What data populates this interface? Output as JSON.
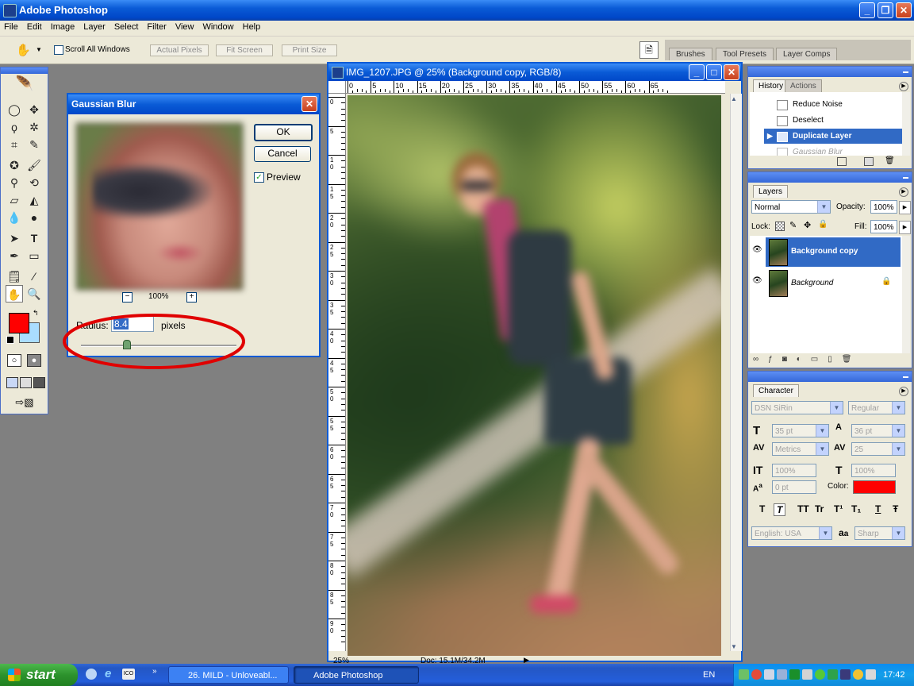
{
  "app": {
    "title": "Adobe Photoshop"
  },
  "menu": [
    "File",
    "Edit",
    "Image",
    "Layer",
    "Select",
    "Filter",
    "View",
    "Window",
    "Help"
  ],
  "options": {
    "scroll_all_windows": "Scroll All Windows",
    "actual_pixels": "Actual Pixels",
    "fit_screen": "Fit Screen",
    "print_size": "Print Size",
    "well_tabs": [
      "Brushes",
      "Tool Presets",
      "Layer Comps"
    ]
  },
  "colors": {
    "foreground": "#ff0000",
    "background": "#aaddff",
    "accent": "#0a5bd6",
    "annotation": "#e00000"
  },
  "gaussian_blur": {
    "title": "Gaussian Blur",
    "ok": "OK",
    "cancel": "Cancel",
    "preview_label": "Preview",
    "preview_checked": true,
    "zoom": "100%",
    "zoom_out": "−",
    "zoom_in": "+",
    "radius_label": "Radius:",
    "radius_value": "8.4",
    "unit": "pixels",
    "slider_fraction": 0.29
  },
  "document": {
    "title": "IMG_1207.JPG @ 25% (Background copy, RGB/8)",
    "ruler_top": [
      "0",
      "5",
      "10",
      "15",
      "20",
      "25",
      "30",
      "35",
      "40",
      "45",
      "50",
      "55",
      "60",
      "65"
    ],
    "ruler_left": [
      "0",
      "5",
      "1\n0",
      "1\n5",
      "2\n0",
      "2\n5",
      "3\n0",
      "3\n5",
      "4\n0",
      "4\n5",
      "5\n0",
      "5\n5",
      "6\n0",
      "6\n5",
      "7\n0",
      "7\n5",
      "8\n0",
      "8\n5",
      "9\n0"
    ],
    "status_zoom": "25%",
    "status_doc": "Doc: 15.1M/34.2M"
  },
  "history": {
    "tabs": [
      "History",
      "Actions"
    ],
    "items": [
      {
        "label": "Reduce Noise",
        "state": "normal"
      },
      {
        "label": "Deselect",
        "state": "normal"
      },
      {
        "label": "Duplicate Layer",
        "state": "selected"
      },
      {
        "label": "Gaussian Blur",
        "state": "undone"
      }
    ]
  },
  "layers": {
    "tab": "Layers",
    "blend_mode": "Normal",
    "opacity_label": "Opacity:",
    "opacity": "100%",
    "lock_label": "Lock:",
    "fill_label": "Fill:",
    "fill": "100%",
    "items": [
      {
        "name": "Background copy",
        "selected": true,
        "locked": false
      },
      {
        "name": "Background",
        "selected": false,
        "locked": true
      }
    ]
  },
  "character": {
    "tab": "Character",
    "font_family": "DSN SiRin",
    "font_style": "Regular",
    "size": "35 pt",
    "leading": "36 pt",
    "kerning": "Metrics",
    "tracking": "25",
    "vscale": "100%",
    "hscale": "100%",
    "baseline": "0 pt",
    "color_label": "Color:",
    "color": "#ff0000",
    "style_buttons": [
      "T",
      "T",
      "TT",
      "Tr",
      "T¹",
      "T₁",
      "T",
      "Ŧ"
    ],
    "language": "English: USA",
    "aa_label": "a",
    "antialias": "Sharp"
  },
  "taskbar": {
    "start": "start",
    "tasks": [
      {
        "label": "26. MILD - Unloveabl...",
        "active": false
      },
      {
        "label": "Adobe Photoshop",
        "active": true
      }
    ],
    "lang": "EN",
    "clock": "17:42"
  }
}
